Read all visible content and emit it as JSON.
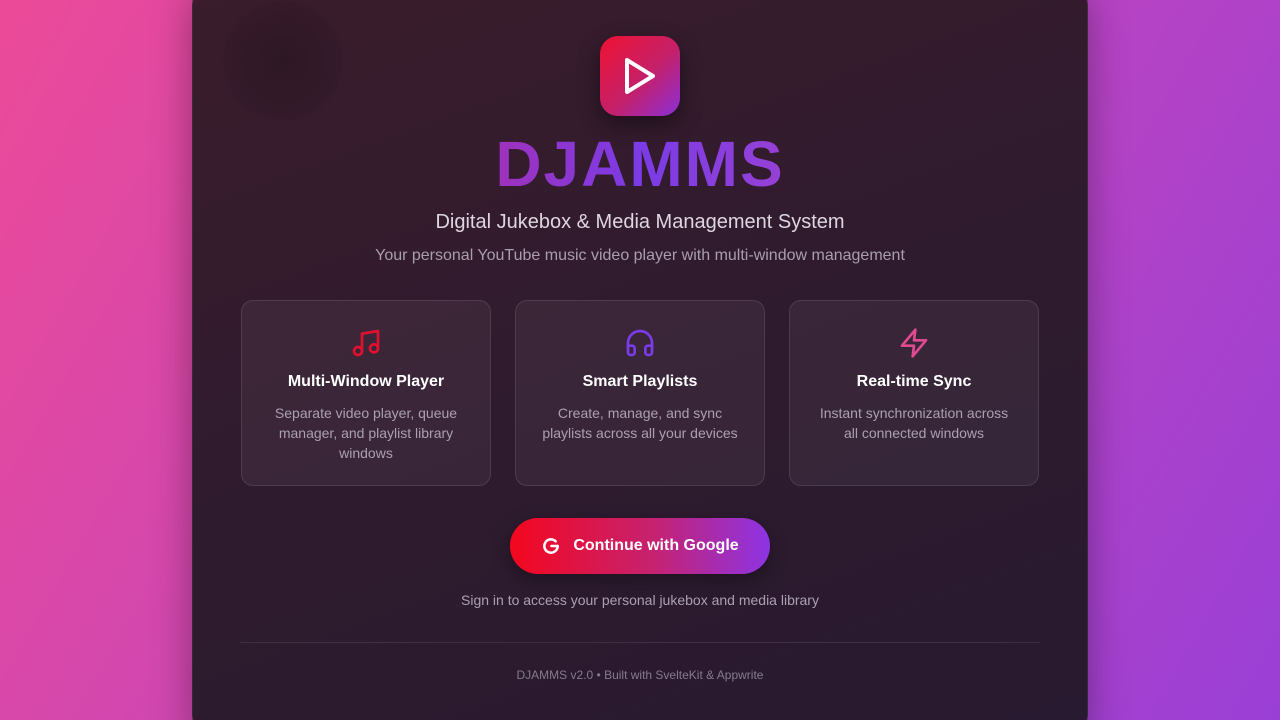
{
  "app": {
    "name": "DJAMMS",
    "subtitle": "Digital Jukebox & Media Management System",
    "tagline": "Your personal YouTube music video player with multi-window management"
  },
  "logo": {
    "icon": "play-icon"
  },
  "features": [
    {
      "icon": "music-note-icon",
      "icon_color": "#e0102e",
      "title": "Multi-Window Player",
      "description": "Separate video player, queue manager, and playlist library windows"
    },
    {
      "icon": "headphones-icon",
      "icon_color": "#7b3be6",
      "title": "Smart Playlists",
      "description": "Create, manage, and sync playlists across all your devices"
    },
    {
      "icon": "lightning-icon",
      "icon_color": "#e04a90",
      "title": "Real-time Sync",
      "description": "Instant synchronization across all connected windows"
    }
  ],
  "cta": {
    "label": "Continue with Google",
    "icon": "google-icon"
  },
  "signin_note": "Sign in to access your personal jukebox and media library",
  "footer": "DJAMMS v2.0 • Built with SvelteKit & Appwrite",
  "colors": {
    "accent_red": "#f4071e",
    "accent_purple": "#8d34e4",
    "accent_pink": "#e84aa0"
  }
}
